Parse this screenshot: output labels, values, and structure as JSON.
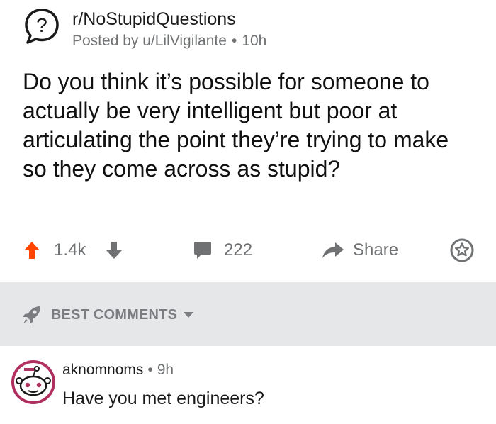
{
  "post": {
    "subreddit": "r/NoStupidQuestions",
    "posted_by": "Posted by u/LilVigilante",
    "age": "10h",
    "title": "Do you think it’s possible for someone to actually be very intelligent but poor at articulating the point they’re trying to make so they come across as stupid?",
    "vote_count": "1.4k",
    "comment_count": "222",
    "share_label": "Share"
  },
  "comments_section": {
    "sort_label": "BEST COMMENTS"
  },
  "comment": {
    "username": "aknomnoms",
    "age": "9h",
    "body": "Have you met engineers?"
  },
  "colors": {
    "upvote": "#ff4500",
    "muted": "#6f7173",
    "band": "#e5e7e9",
    "avatar_ring": "#b03060"
  },
  "icons": [
    "question-mark-icon",
    "upvote-arrow-icon",
    "downvote-arrow-icon",
    "comment-bubble-icon",
    "share-arrow-icon",
    "award-icon",
    "rocket-icon",
    "chevron-down-icon",
    "snoo-avatar-icon"
  ]
}
